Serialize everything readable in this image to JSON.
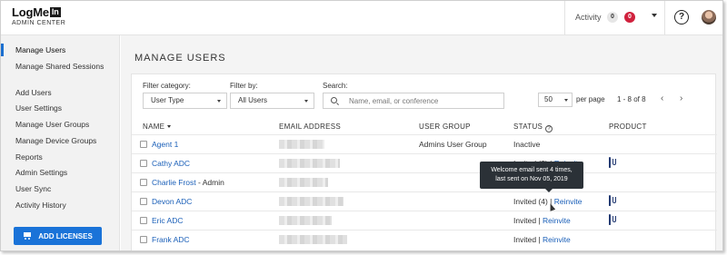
{
  "header": {
    "logo_text": "LogMe",
    "logo_box": "In",
    "logo_sub": "ADMIN CENTER",
    "activity_label": "Activity",
    "activity_count": "0",
    "alert_count": "0",
    "help_glyph": "?",
    "icons": [
      "help-icon",
      "avatar",
      "chevron-down-icon"
    ]
  },
  "sidebar": {
    "items": [
      {
        "label": "Manage Users",
        "active": true
      },
      {
        "label": "Manage Shared Sessions"
      },
      {
        "label": "Add Users"
      },
      {
        "label": "User Settings"
      },
      {
        "label": "Manage User Groups"
      },
      {
        "label": "Manage Device Groups"
      },
      {
        "label": "Reports"
      },
      {
        "label": "Admin Settings"
      },
      {
        "label": "User Sync"
      },
      {
        "label": "Activity History"
      }
    ],
    "add_licenses_label": "ADD LICENSES"
  },
  "main": {
    "title": "MANAGE USERS",
    "filters": {
      "category_label": "Filter category:",
      "category_value": "User Type",
      "by_label": "Filter by:",
      "by_value": "All Users",
      "search_label": "Search:",
      "search_placeholder": "Name, email, or conference"
    },
    "pagination": {
      "per_page_value": "50",
      "per_page_label": "per page",
      "range": "1 - 8 of 8",
      "prev": "‹",
      "next": "›"
    },
    "columns": {
      "name": "NAME",
      "email": "EMAIL ADDRESS",
      "group": "USER GROUP",
      "status": "STATUS",
      "product": "PRODUCT"
    },
    "rows": [
      {
        "name": "Agent 1",
        "suffix": "",
        "group": "Admins User Group",
        "status": "Inactive",
        "status_link": "",
        "sep": "",
        "product": "plus"
      },
      {
        "name": "Cathy ADC",
        "suffix": "",
        "group": "",
        "status": "Invited (2)",
        "status_link": "Reinvite",
        "sep": " | ",
        "product": "gtm"
      },
      {
        "name": "Charlie Frost",
        "suffix": " - Admin",
        "group": "",
        "status": "",
        "status_link": "",
        "sep": "",
        "product": ""
      },
      {
        "name": "Devon ADC",
        "suffix": "",
        "group": "",
        "status": "Invited (4)",
        "status_link": "Reinvite",
        "sep": " | ",
        "product": "gtm"
      },
      {
        "name": "Eric ADC",
        "suffix": "",
        "group": "",
        "status": "Invited",
        "status_link": "Reinvite",
        "sep": " | ",
        "product": "gtm"
      },
      {
        "name": "Frank ADC",
        "suffix": "",
        "group": "",
        "status": "Invited",
        "status_link": "Reinvite",
        "sep": " | ",
        "product": "plus"
      }
    ],
    "tooltip": {
      "line1": "Welcome email sent 4 times,",
      "line2": "last sent on Nov 05, 2019"
    }
  },
  "colors": {
    "accent": "#1a73d8",
    "link": "#1a5fb8",
    "badge_red": "#d0213d",
    "product_teal": "#0b5b67",
    "product_navy": "#243b73",
    "tooltip_bg": "#2b3137"
  }
}
